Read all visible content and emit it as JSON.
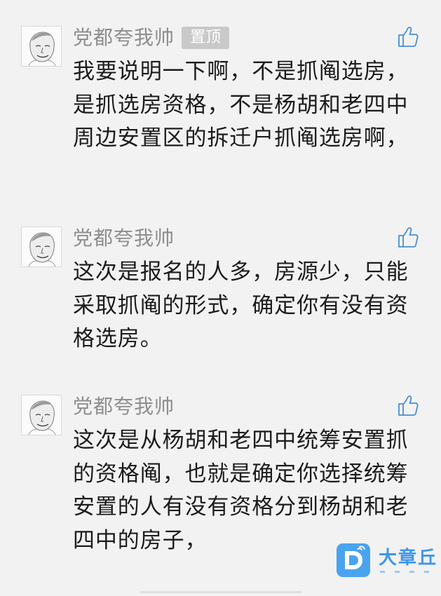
{
  "comments": [
    {
      "author": "党都夸我帅",
      "pin_label": "置顶",
      "text": "我要说明一下啊，不是抓阄选房，是抓选房资格，不是杨胡和老四中周边安置区的拆迁户抓阄选房啊，"
    },
    {
      "author": "党都夸我帅",
      "text": "这次是报名的人多，房源少，只能采取抓阄的形式，确定你有没有资格选房。"
    },
    {
      "author": "党都夸我帅",
      "text": "这次是从杨胡和老四中统筹安置抓的资格阄，也就是确定你选择统筹安置的人有没有资格分到杨胡和老四中的房子，"
    }
  ],
  "watermark": {
    "brand": "大章丘",
    "icon": "d-chat-logo-icon"
  },
  "colors": {
    "background": "#f2f2f2",
    "author": "#8e8e8e",
    "text": "#1c1c1c",
    "pin_badge": "#c9c9c9",
    "like_icon": "#4a8fcf",
    "brand": "#3d97e6"
  }
}
